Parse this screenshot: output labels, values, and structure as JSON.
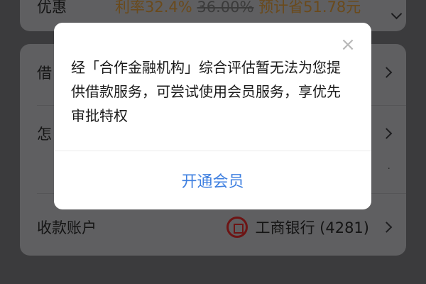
{
  "promo": {
    "label": "优惠",
    "rate_text": "利率32.4%",
    "old_rate": "36.00%",
    "savings": "预计省51.78元"
  },
  "rows": {
    "borrow_label": "借",
    "how_label": "怎",
    "dots": "·",
    "account_label": "收款账户",
    "bank_name": "工商银行 (4281)"
  },
  "dialog": {
    "close_glyph": "×",
    "message": "经「合作金融机构」综合评估暂无法为您提供借款服务，可尝试使用会员服务，享优先审批特权",
    "action_label": "开通会员"
  }
}
